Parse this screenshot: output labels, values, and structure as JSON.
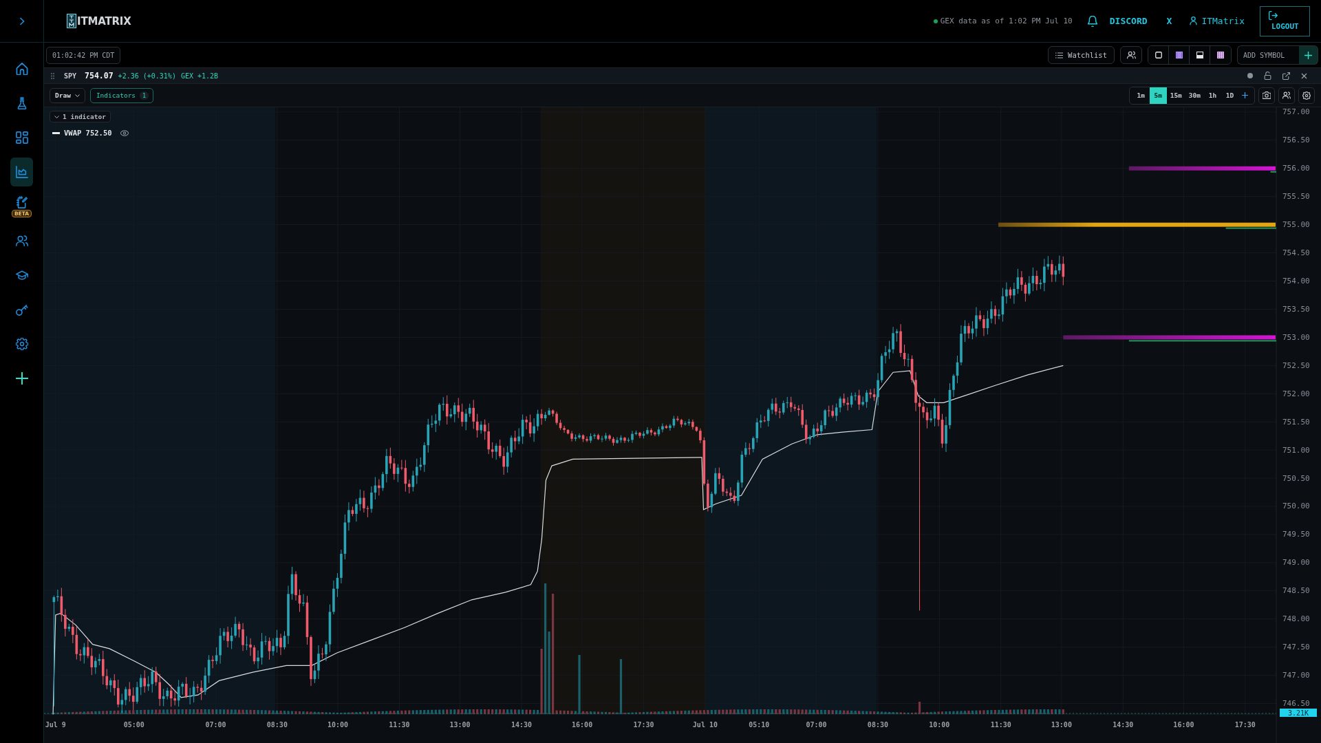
{
  "sidebar": {
    "items": [
      {
        "kind": "home",
        "selected": false
      },
      {
        "kind": "lab",
        "selected": false
      },
      {
        "kind": "dashboard",
        "selected": false
      },
      {
        "kind": "chart",
        "selected": true
      },
      {
        "kind": "journal",
        "selected": false,
        "badge": "BETA"
      },
      {
        "kind": "community",
        "selected": false
      },
      {
        "kind": "education",
        "selected": false
      },
      {
        "kind": "key",
        "selected": false
      },
      {
        "kind": "settings",
        "selected": false
      },
      {
        "kind": "add",
        "selected": false
      }
    ]
  },
  "header": {
    "logo": "ITMATRIX",
    "gex_status": "GEX data as of 1:02 PM Jul 10",
    "links": [
      "DISCORD",
      "X"
    ],
    "user": "ITMatrix",
    "logout": "LOGOUT"
  },
  "toolbar": {
    "clock": "01:02:42 PM CDT",
    "watchlist": "Watchlist",
    "layouts": [
      {
        "kind": "single"
      },
      {
        "kind": "columns"
      },
      {
        "kind": "rows"
      },
      {
        "kind": "grid"
      }
    ],
    "add_symbol": {
      "placeholder": "ADD SYMBOL"
    }
  },
  "chart_panel": {
    "symbol": "SPY",
    "price": "754.07",
    "change": "+2.36 (+0.31%)",
    "gex": "GEX +1.2B",
    "draw": "Draw",
    "indicators": {
      "label": "Indicators",
      "count": "1"
    },
    "timeframes": [
      {
        "label": "1m",
        "selected": false
      },
      {
        "label": "5m",
        "selected": true
      },
      {
        "label": "15m",
        "selected": false
      },
      {
        "label": "30m",
        "selected": false
      },
      {
        "label": "1h",
        "selected": false
      },
      {
        "label": "1D",
        "selected": false
      }
    ],
    "legend": {
      "toggle": "1 indicator",
      "items": [
        "VWAP 752.50"
      ]
    },
    "price_axis": [
      "757.00",
      "756.50",
      "756.00",
      "755.50",
      "755.00",
      "754.50",
      "754.00",
      "753.50",
      "753.00",
      "752.50",
      "752.00",
      "751.50",
      "751.00",
      "750.50",
      "750.00",
      "749.50",
      "749.00",
      "748.50",
      "748.00",
      "747.50",
      "747.00",
      "746.50"
    ],
    "time_axis": [
      "Jul 9",
      "05:00",
      "07:00",
      "08:30",
      "10:00",
      "11:30",
      "13:00",
      "14:30",
      "16:00",
      "17:30",
      "Jul 10",
      "05:10",
      "07:00",
      "08:30",
      "10:00",
      "11:30",
      "13:00",
      "14:30",
      "16:00",
      "17:30"
    ],
    "volume_tag": "3.21K"
  }
}
